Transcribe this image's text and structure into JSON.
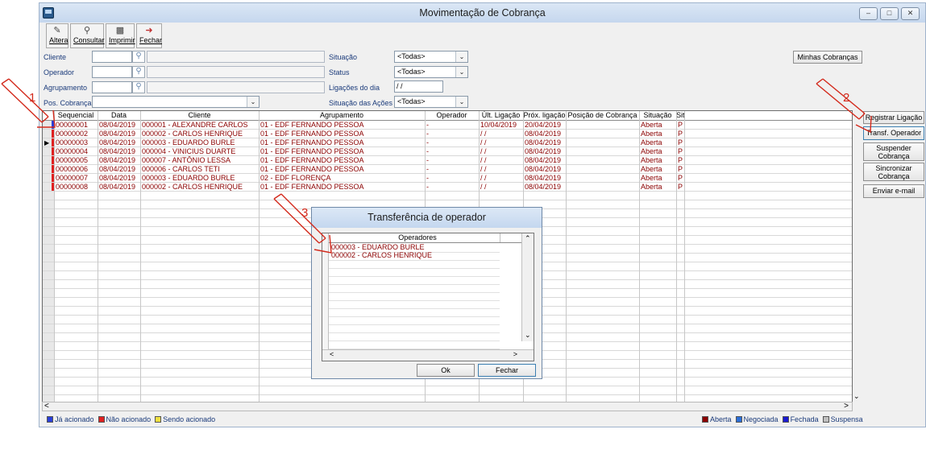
{
  "window": {
    "title": "Movimentação de Cobrança",
    "controls": [
      "minimize-icon",
      "restore-icon",
      "close-icon"
    ]
  },
  "toolbar": [
    {
      "label": "Altera",
      "icon": "edit-icon"
    },
    {
      "label": "Consultar",
      "icon": "search-icon"
    },
    {
      "label": "Imprimir",
      "icon": "printer-icon"
    },
    {
      "label": "Fechar",
      "icon": "exit-icon"
    }
  ],
  "filters": {
    "cliente_label": "Cliente",
    "operador_label": "Operador",
    "agrupamento_label": "Agrupamento",
    "pos_cobranca_label": "Pos. Cobrança",
    "situacao_label": "Situação",
    "situacao_value": "<Todas>",
    "status_label": "Status",
    "status_value": "<Todas>",
    "ligacoes_label": "Ligações do dia",
    "ligacoes_value": " / /",
    "situacao_acoes_label": "Situação das Ações",
    "situacao_acoes_value": "<Todas>",
    "minhas_cobrancas": "Minhas Cobranças"
  },
  "grid": {
    "headers": [
      "Sequencial",
      "Data",
      "Cliente",
      "Agrupamento",
      "Operador",
      "Últ. Ligação",
      "Próx. ligação",
      "Posição de Cobrança",
      "Situação",
      "Sit"
    ],
    "rows": [
      [
        "00000001",
        "08/04/2019",
        "000001 - ALEXANDRE CARLOS",
        "01 - EDF FERNANDO PESSOA",
        "-",
        "10/04/2019",
        "20/04/2019",
        "",
        "Aberta",
        "P"
      ],
      [
        "00000002",
        "08/04/2019",
        "000002 - CARLOS HENRIQUE",
        "01 - EDF FERNANDO PESSOA",
        "-",
        "/ /",
        "08/04/2019",
        "",
        "Aberta",
        "P"
      ],
      [
        "00000003",
        "08/04/2019",
        "000003 - EDUARDO BURLE",
        "01 - EDF FERNANDO PESSOA",
        "-",
        "/ /",
        "08/04/2019",
        "",
        "Aberta",
        "P"
      ],
      [
        "00000004",
        "08/04/2019",
        "000004 - VINICIUS DUARTE",
        "01 - EDF FERNANDO PESSOA",
        "-",
        "/ /",
        "08/04/2019",
        "",
        "Aberta",
        "P"
      ],
      [
        "00000005",
        "08/04/2019",
        "000007 - ANTÔNIO LESSA",
        "01 - EDF FERNANDO PESSOA",
        "-",
        "/ /",
        "08/04/2019",
        "",
        "Aberta",
        "P"
      ],
      [
        "00000006",
        "08/04/2019",
        "000006 - CARLOS TETI",
        "01 - EDF FERNANDO PESSOA",
        "-",
        "/ /",
        "08/04/2019",
        "",
        "Aberta",
        "P"
      ],
      [
        "00000007",
        "08/04/2019",
        "000003 - EDUARDO BURLE",
        "02 - EDF FLORENÇA",
        "-",
        "/ /",
        "08/04/2019",
        "",
        "Aberta",
        "P"
      ],
      [
        "00000008",
        "08/04/2019",
        "000002 - CARLOS HENRIQUE",
        "01 - EDF FERNANDO PESSOA",
        "-",
        "/ /",
        "08/04/2019",
        "",
        "Aberta",
        "P"
      ]
    ],
    "row_marks": [
      "#2b3fd8",
      "#e02020",
      "#e02020",
      "#e02020",
      "#e02020",
      "#e02020",
      "#e02020",
      "#e02020"
    ]
  },
  "side_buttons": [
    "Registrar Ligação",
    "Transf. Operador",
    "Suspender Cobrança",
    "Sincronizar Cobrança",
    "Enviar e-mail"
  ],
  "dialog": {
    "title": "Transferência de operador",
    "header": "Operadores",
    "rows": [
      "000003 - EDUARDO BURLE",
      "000002 - CARLOS HENRIQUE"
    ],
    "ok": "Ok",
    "close": "Fechar"
  },
  "legend_left": [
    {
      "label": "Já acionado",
      "color": "#2b3fd8"
    },
    {
      "label": "Não acionado",
      "color": "#e02020"
    },
    {
      "label": "Sendo acionado",
      "color": "#f0e040"
    }
  ],
  "legend_right": [
    {
      "label": "Aberta",
      "color": "#8b0000"
    },
    {
      "label": "Negociada",
      "color": "#2b6fd8"
    },
    {
      "label": "Fechada",
      "color": "#1a1ad0"
    },
    {
      "label": "Suspensa",
      "color": "#c0c0c0"
    }
  ],
  "annotations": [
    "1",
    "2",
    "3"
  ]
}
